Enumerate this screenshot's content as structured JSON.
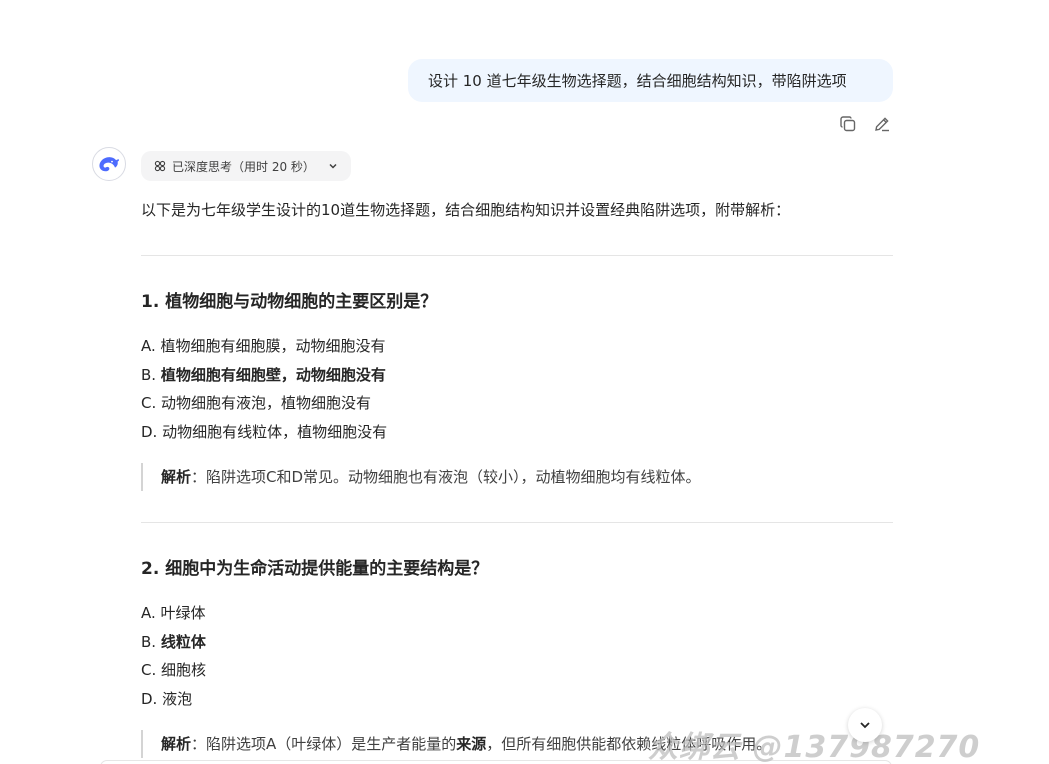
{
  "user_message": "设计 10 道七年级生物选择题，结合细胞结构知识，带陷阱选项",
  "message_actions": [
    {
      "icon": "copy-icon"
    },
    {
      "icon": "edit-icon"
    }
  ],
  "assistant": {
    "think_label": "已深度思考（用时 20 秒）",
    "intro": "以下是为七年级学生设计的10道生物选择题，结合细胞结构知识并设置经典陷阱选项，附带解析：",
    "questions": [
      {
        "title": "1. 植物细胞与动物细胞的主要区别是？",
        "options": [
          {
            "letter": "A.",
            "text": "植物细胞有细胞膜，动物细胞没有",
            "bold": false
          },
          {
            "letter": "B.",
            "text": "植物细胞有细胞壁，动物细胞没有",
            "bold": true
          },
          {
            "letter": "C.",
            "text": "动物细胞有液泡，植物细胞没有",
            "bold": false
          },
          {
            "letter": "D.",
            "text": "动物细胞有线粒体，植物细胞没有",
            "bold": false
          }
        ],
        "analysis_label": "解析",
        "analysis_text": "：陷阱选项C和D常见。动物细胞也有液泡（较小），动植物细胞均有线粒体。"
      },
      {
        "title": "2. 细胞中为生命活动提供能量的主要结构是？",
        "options": [
          {
            "letter": "A.",
            "text": "叶绿体",
            "bold": false
          },
          {
            "letter": "B.",
            "text": "线粒体",
            "bold": true
          },
          {
            "letter": "C.",
            "text": "细胞核",
            "bold": false
          },
          {
            "letter": "D.",
            "text": "液泡",
            "bold": false
          }
        ],
        "analysis_label": "解析",
        "analysis_pre": "：陷阱选项A（叶绿体）是生产者能量的",
        "analysis_bold": "来源",
        "analysis_post": "，但所有细胞供能都依赖线粒体呼吸作用。"
      }
    ]
  },
  "watermark": "众绑云 @137987270",
  "colors": {
    "bubble_bg": "#eff6ff",
    "accent": "#4d6bfe"
  }
}
